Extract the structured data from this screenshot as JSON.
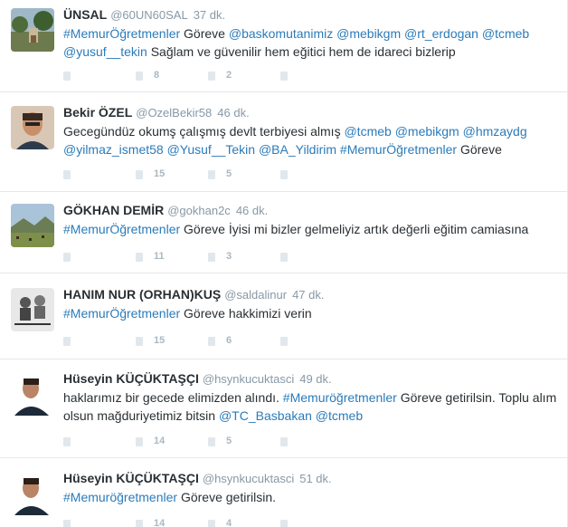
{
  "tweets": [
    {
      "fullname": "ÜNSAL",
      "username": "@60UN60SAL",
      "time": "37 dk.",
      "segments": [
        {
          "t": "#MemurÖğretmenler",
          "link": true
        },
        {
          "t": " Göreve ",
          "link": false
        },
        {
          "t": "@baskomutanimiz",
          "link": true
        },
        {
          "t": " ",
          "link": false
        },
        {
          "t": "@mebikgm",
          "link": true
        },
        {
          "t": "  ",
          "link": false
        },
        {
          "t": "@rt_erdogan",
          "link": true
        },
        {
          "t": " ",
          "link": false
        },
        {
          "t": "@tcmeb",
          "link": true
        },
        {
          "t": " ",
          "link": false
        },
        {
          "t": "@yusuf__tekin",
          "link": true
        },
        {
          "t": " Sağlam ve güvenilir hem eğitici hem de idareci bizlerip",
          "link": false
        }
      ],
      "retweets": "8",
      "likes": "2",
      "avatar": "outdoor-trees-avatar"
    },
    {
      "fullname": "Bekir ÖZEL",
      "username": "@OzelBekir58",
      "time": "46 dk.",
      "segments": [
        {
          "t": "Gecegündüz okumş çalışmış devlt terbiyesi almış ",
          "link": false
        },
        {
          "t": "@tcmeb",
          "link": true
        },
        {
          "t": " ",
          "link": false
        },
        {
          "t": "@mebikgm",
          "link": true
        },
        {
          "t": " ",
          "link": false
        },
        {
          "t": "@hmzaydg",
          "link": true
        },
        {
          "t": " ",
          "link": false
        },
        {
          "t": "@yilmaz_ismet58",
          "link": true
        },
        {
          "t": " ",
          "link": false
        },
        {
          "t": "@Yusuf__Tekin",
          "link": true
        },
        {
          "t": " ",
          "link": false
        },
        {
          "t": "@BA_Yildirim",
          "link": true
        },
        {
          "t": " ",
          "link": false
        },
        {
          "t": "#MemurÖğretmenler",
          "link": true
        },
        {
          "t": " Göreve",
          "link": false
        }
      ],
      "retweets": "15",
      "likes": "5",
      "avatar": "man-portrait-avatar"
    },
    {
      "fullname": "GÖKHAN DEMİR",
      "username": "@gokhan2c",
      "time": "46 dk.",
      "segments": [
        {
          "t": "#MemurÖğretmenler",
          "link": true
        },
        {
          "t": " Göreve İyisi mi bizler gelmeliyiz artık değerli  eğitim camiasına",
          "link": false
        }
      ],
      "retweets": "11",
      "likes": "3",
      "avatar": "landscape-avatar"
    },
    {
      "fullname": "HANIM NUR (ORHAN)KUŞ",
      "username": "@saldalinur",
      "time": "47 dk.",
      "segments": [
        {
          "t": "#MemurÖğretmenler",
          "link": true
        },
        {
          "t": " Göreve hakkimizi verin",
          "link": false
        }
      ],
      "retweets": "15",
      "likes": "6",
      "avatar": "people-sketch-avatar"
    },
    {
      "fullname": "Hüseyin KÜÇÜKTAŞÇI",
      "username": "@hsynkucuktasci",
      "time": "49 dk.",
      "segments": [
        {
          "t": "haklarımız bir gecede elimizden alındı. ",
          "link": false
        },
        {
          "t": "#Memuröğretmenler",
          "link": true
        },
        {
          "t": " Göreve getirilsin. Toplu alım olsun mağduriyetimiz bitsin ",
          "link": false
        },
        {
          "t": "@TC_Basbakan",
          "link": true
        },
        {
          "t": " ",
          "link": false
        },
        {
          "t": "@tcmeb",
          "link": true
        }
      ],
      "retweets": "14",
      "likes": "5",
      "avatar": "man-photo-avatar"
    },
    {
      "fullname": "Hüseyin KÜÇÜKTAŞÇI",
      "username": "@hsynkucuktasci",
      "time": "51 dk.",
      "segments": [
        {
          "t": "#Memuröğretmenler",
          "link": true
        },
        {
          "t": " Göreve getirilsin.",
          "link": false
        }
      ],
      "retweets": "14",
      "likes": "4",
      "avatar": "man-photo-avatar"
    }
  ],
  "colors": {
    "link": "#2b7bb9",
    "text": "#292f33",
    "meta": "#8899a6",
    "divider": "#e1e8ed"
  }
}
